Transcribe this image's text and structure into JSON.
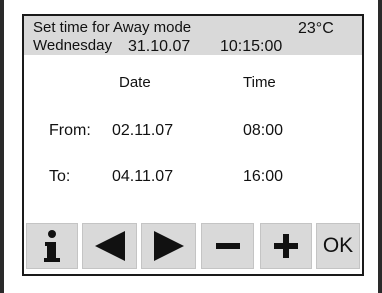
{
  "header": {
    "title": "Set time for Away mode",
    "temperature": "23°C",
    "weekday": "Wednesday",
    "date": "31.10.07",
    "time": "10:15:00"
  },
  "table": {
    "columns": [
      "Date",
      "Time"
    ],
    "rows": [
      {
        "label": "From:",
        "date": "02.11.07",
        "time": "08:00"
      },
      {
        "label": "To:",
        "date": "04.11.07",
        "time": "16:00"
      }
    ]
  },
  "toolbar": {
    "buttons": [
      {
        "icon": "info-icon"
      },
      {
        "icon": "arrow-left-icon"
      },
      {
        "icon": "arrow-right-icon"
      },
      {
        "icon": "minus-icon"
      },
      {
        "icon": "plus-icon"
      },
      {
        "label": "OK"
      }
    ]
  },
  "colors": {
    "header_bg": "#d9d9d9",
    "button_bg": "#d9d9d9",
    "frame": "#1a1a1a",
    "text": "#111111"
  }
}
